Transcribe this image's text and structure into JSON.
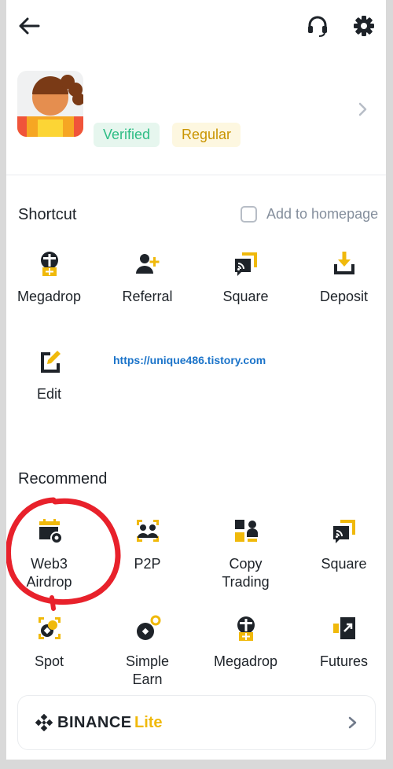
{
  "profile": {
    "badges": {
      "verified": "Verified",
      "regular": "Regular"
    }
  },
  "shortcut": {
    "title": "Shortcut",
    "add_to_homepage": "Add to homepage",
    "items": [
      {
        "label": "Megadrop",
        "icon": "megadrop-icon"
      },
      {
        "label": "Referral",
        "icon": "referral-icon"
      },
      {
        "label": "Square",
        "icon": "square-icon"
      },
      {
        "label": "Deposit",
        "icon": "deposit-icon"
      },
      {
        "label": "Edit",
        "icon": "edit-icon"
      }
    ]
  },
  "watermark": "https://unique486.tistory.com",
  "recommend": {
    "title": "Recommend",
    "items": [
      {
        "label": "Web3\nAirdrop",
        "icon": "web3-airdrop-icon"
      },
      {
        "label": "P2P",
        "icon": "p2p-icon"
      },
      {
        "label": "Copy\nTrading",
        "icon": "copy-trading-icon"
      },
      {
        "label": "Square",
        "icon": "square-icon"
      },
      {
        "label": "Spot",
        "icon": "spot-icon"
      },
      {
        "label": "Simple\nEarn",
        "icon": "simple-earn-icon"
      },
      {
        "label": "Megadrop",
        "icon": "megadrop-icon"
      },
      {
        "label": "Futures",
        "icon": "futures-icon"
      }
    ]
  },
  "lite_bar": {
    "brand": "BINANCE",
    "suffix": "Lite"
  },
  "colors": {
    "accent": "#f0b90b",
    "text": "#1e2329",
    "muted": "#848e9c",
    "verified": "#2ebd85",
    "annotation": "#e8212b"
  }
}
